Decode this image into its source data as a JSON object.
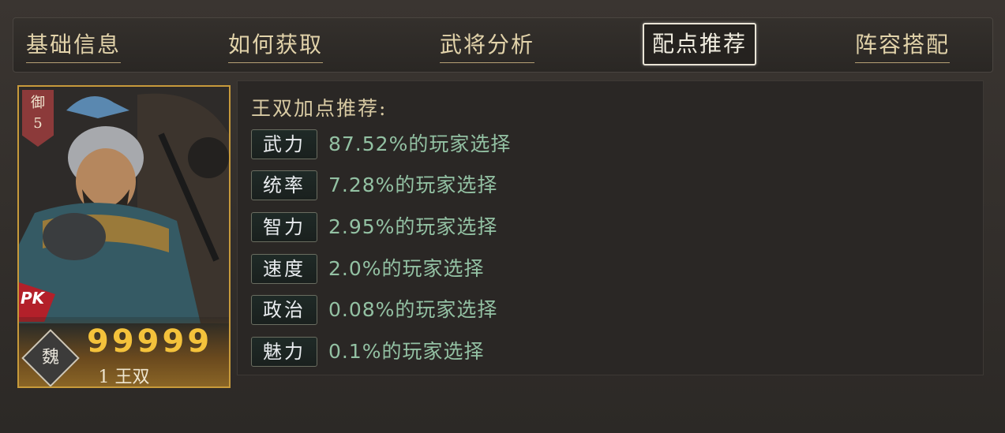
{
  "tabs": [
    {
      "label": "基础信息",
      "active": false
    },
    {
      "label": "如何获取",
      "active": false
    },
    {
      "label": "武将分析",
      "active": false
    },
    {
      "label": "配点推荐",
      "active": true
    },
    {
      "label": "阵容搭配",
      "active": false
    }
  ],
  "hero": {
    "rank_char": "御",
    "rank_num": "5",
    "pk": "PK",
    "faction": "魏",
    "stars": "99999",
    "name": "1 王双"
  },
  "headline": "王双加点推荐:",
  "stats": [
    {
      "label": "武力",
      "text": "87.52%的玩家选择"
    },
    {
      "label": "统率",
      "text": "7.28%的玩家选择"
    },
    {
      "label": "智力",
      "text": "2.95%的玩家选择"
    },
    {
      "label": "速度",
      "text": "2.0%的玩家选择"
    },
    {
      "label": "政治",
      "text": "0.08%的玩家选择"
    },
    {
      "label": "魅力",
      "text": "0.1%的玩家选择"
    }
  ]
}
